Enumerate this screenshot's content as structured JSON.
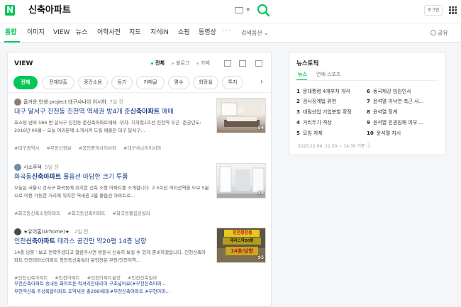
{
  "header": {
    "logo": "N",
    "query": "신축아파트",
    "login_label": "로그인"
  },
  "nav": {
    "tabs": [
      {
        "label": "통합",
        "active": true
      },
      {
        "label": "이미지"
      },
      {
        "label": "VIEW"
      },
      {
        "label": "뉴스"
      },
      {
        "label": "어학사전"
      },
      {
        "label": "지도"
      },
      {
        "label": "지식iN"
      },
      {
        "label": "쇼핑"
      },
      {
        "label": "동영상"
      }
    ],
    "more": "···",
    "search_option": "검색옵션 ⌄",
    "share": "공유"
  },
  "view": {
    "title": "VIEW",
    "filters": [
      "전체",
      "블로그",
      "카페"
    ],
    "categories": [
      "전체",
      "전체대출",
      "중간소음",
      "등기",
      "카페글",
      "평수",
      "화장실",
      "투지"
    ]
  },
  "posts": [
    {
      "author": "즐거운 인생 project 대구사나이 이서하",
      "date": "7일 전",
      "title_pre": "대구 달서구 진천동 진천역 역세권 방4개 준",
      "title_bold": "신축아파트",
      "title_post": " 매매",
      "desc": "포스팅 넘버 586 번 달서구 진천동 준신축아파트매매 -위치: 지하철1호선 진천역 부근 -준공년도: 2016년 06월~ 오늘 여러분께 소개시켜 드릴 매물은 대구 달서구...",
      "tags": [
        "#대구광역시",
        "#부동산정보",
        "#공인중개사이서하",
        "#대구사나이이서하"
      ],
      "thumb_count": "54"
    },
    {
      "author": "시소주택",
      "date": "5일 전",
      "title_pre": "화곡동",
      "title_bold": "신축아파트",
      "title_post": " 풀옵션 아담한 크기 투룸",
      "desc": "오늘은 서울시 강서구 화곡동에 위치한 신축 소형 아파트를 소개합니다. 2.5호선 까치산역을 도보 5분으로 이용 가능한 거리에 위치한 역세권 2룸 풀옵션 아파트로...",
      "tags": [
        "#화곡동신축소형아파트",
        "#화곡동신축아파트",
        "#화곡동풀옵션빌라"
      ],
      "thumb_count": "38"
    },
    {
      "author": "★유어홈(Urhome)★",
      "date": "2일 전",
      "title_pre": "인천",
      "title_bold": "신축아파트",
      "title_post": " 테라스 공간만 약20평 14층 남향",
      "desc": "14층 남향 ' 보고 연락주셨다고 말씀주시면 방문시 신속히 보실 수 있게 준비하겠습니다. 인천신축아파트 인천테라스아파트 청천동신축빌라 분양전문 부천/인천지역...",
      "tags": [
        "#인천신축아파트",
        "#인천아파트",
        "#인천아파트분양",
        "#인천신축빌라"
      ],
      "thumb_count": "95",
      "thumb_text_1": "인천청천동",
      "thumb_text_2": "테라스약20평",
      "thumb_text_3": "14층/남향",
      "sub_link_1": "부천신축아파트 송내동 화이트톤 럭셔리인테리어 구조넓어요(#부천신축아파...",
      "sub_link_2": "부천역신축 주상복합아파트 초역세권 총288세대(#부천신축아파트 #부천아파..."
    }
  ],
  "news_topic": {
    "title": "뉴스토픽",
    "tabs": [
      "뉴스",
      "연예·스포츠"
    ],
    "items": [
      {
        "num": "1",
        "text": "문대통령 4개부처 개각"
      },
      {
        "num": "2",
        "text": "검사징계법 위헌"
      },
      {
        "num": "3",
        "text": "대림산업 기업분할 확정"
      },
      {
        "num": "4",
        "text": "거리두기 격상"
      },
      {
        "num": "5",
        "text": "모임 자제"
      },
      {
        "num": "6",
        "text": "동국제강 임원인사"
      },
      {
        "num": "7",
        "text": "윤석열 이낙연 측근 사..."
      },
      {
        "num": "8",
        "text": "윤석열 징계"
      },
      {
        "num": "9",
        "text": "윤석열 인권침해 여부 ..."
      },
      {
        "num": "10",
        "text": "윤석열 지시"
      }
    ],
    "time": "2020.12.04. 11:30 ~ 14:30 기준 ⓘ"
  },
  "colors": {
    "brand": "#03c75a",
    "link": "#1b3d8c"
  },
  "icons": [
    "search-icon",
    "keyboard-icon",
    "grid-menu-icon",
    "share-icon",
    "chevron-right-icon"
  ]
}
